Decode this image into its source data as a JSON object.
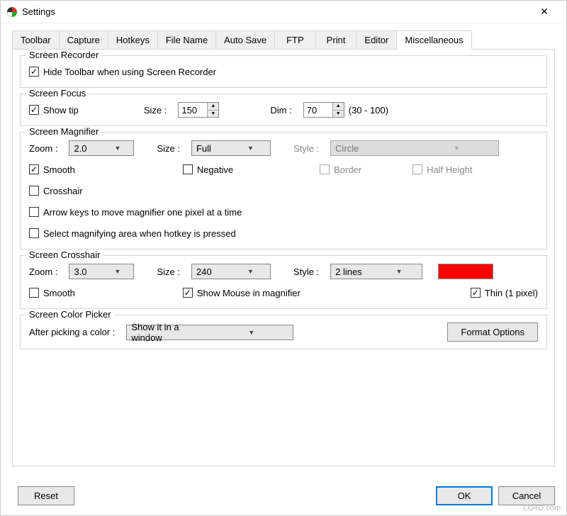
{
  "window": {
    "title": "Settings"
  },
  "tabs": [
    "Toolbar",
    "Capture",
    "Hotkeys",
    "File Name",
    "Auto Save",
    "FTP",
    "Print",
    "Editor",
    "Miscellaneous"
  ],
  "active_tab": "Miscellaneous",
  "recorder": {
    "title": "Screen Recorder",
    "hide_toolbar": {
      "label": "Hide Toolbar when using Screen Recorder",
      "checked": true
    }
  },
  "focus": {
    "title": "Screen Focus",
    "show_tip": {
      "label": "Show tip",
      "checked": true
    },
    "size_label": "Size :",
    "size_value": "150",
    "dim_label": "Dim :",
    "dim_value": "70",
    "dim_range": "(30 - 100)"
  },
  "magnifier": {
    "title": "Screen Magnifier",
    "zoom_label": "Zoom :",
    "zoom_value": "2.0",
    "size_label": "Size :",
    "size_value": "Full",
    "style_label": "Style :",
    "style_value": "Circle",
    "smooth": {
      "label": "Smooth",
      "checked": true
    },
    "negative": {
      "label": "Negative",
      "checked": false
    },
    "border": {
      "label": "Border",
      "checked": false,
      "disabled": true
    },
    "half_height": {
      "label": "Half Height",
      "checked": false,
      "disabled": true
    },
    "crosshair": {
      "label": "Crosshair",
      "checked": false
    },
    "arrow_keys": {
      "label": "Arrow keys to move magnifier one pixel at a time",
      "checked": false
    },
    "select_area": {
      "label": "Select magnifying area when hotkey is pressed",
      "checked": false
    }
  },
  "crosshair": {
    "title": "Screen Crosshair",
    "zoom_label": "Zoom :",
    "zoom_value": "3.0",
    "size_label": "Size :",
    "size_value": "240",
    "style_label": "Style :",
    "style_value": "2 lines",
    "color": "#ff0000",
    "smooth": {
      "label": "Smooth",
      "checked": false
    },
    "show_mouse": {
      "label": "Show Mouse in magnifier",
      "checked": true
    },
    "thin": {
      "label": "Thin (1 pixel)",
      "checked": true
    }
  },
  "picker": {
    "title": "Screen Color Picker",
    "after_label": "After picking a color :",
    "after_value": "Show it in a window",
    "format_btn": "Format Options"
  },
  "buttons": {
    "reset": "Reset",
    "ok": "OK",
    "cancel": "Cancel"
  },
  "watermark": "LO4D.com"
}
